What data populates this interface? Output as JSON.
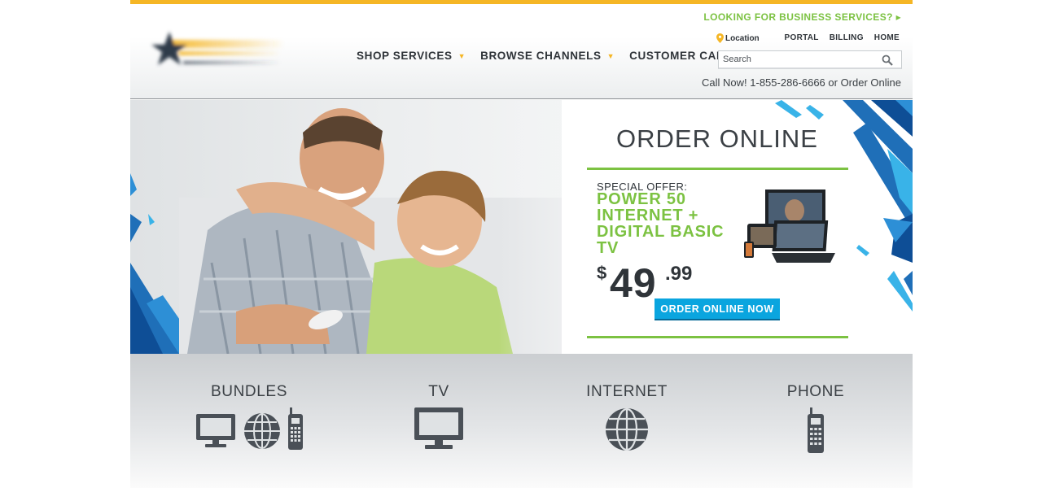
{
  "header": {
    "business_link": "LOOKING FOR BUSINESS SERVICES? ▸",
    "nav": [
      {
        "label": "SHOP SERVICES",
        "has_caret": true
      },
      {
        "label": "BROWSE CHANNELS",
        "has_caret": true
      },
      {
        "label": "CUSTOMER CARE",
        "has_caret": false
      }
    ],
    "location_label": "Location",
    "util_links": [
      "PORTAL",
      "BILLING",
      "HOME"
    ],
    "search_placeholder": "Search",
    "call_now": "Call Now! 1-855-286-6666 or Order Online"
  },
  "hero": {
    "title": "ORDER ONLINE",
    "special_label": "SPECIAL OFFER:",
    "offer_lines": [
      "POWER 50",
      "INTERNET +",
      "DIGITAL BASIC",
      "TV"
    ],
    "price_currency": "$",
    "price_dollars": "49",
    "price_cents": ".99",
    "cta_label": "ORDER ONLINE NOW"
  },
  "services": [
    {
      "label": "BUNDLES",
      "icons": [
        "tv-icon",
        "globe-icon",
        "phone-icon"
      ]
    },
    {
      "label": "TV",
      "icons": [
        "tv-icon"
      ]
    },
    {
      "label": "INTERNET",
      "icons": [
        "globe-icon"
      ]
    },
    {
      "label": "PHONE",
      "icons": [
        "phone-icon"
      ]
    }
  ],
  "colors": {
    "accent_yellow": "#f5b625",
    "accent_green": "#7cc242",
    "cta_blue": "#0aa5df",
    "text_dark": "#2f3439"
  }
}
